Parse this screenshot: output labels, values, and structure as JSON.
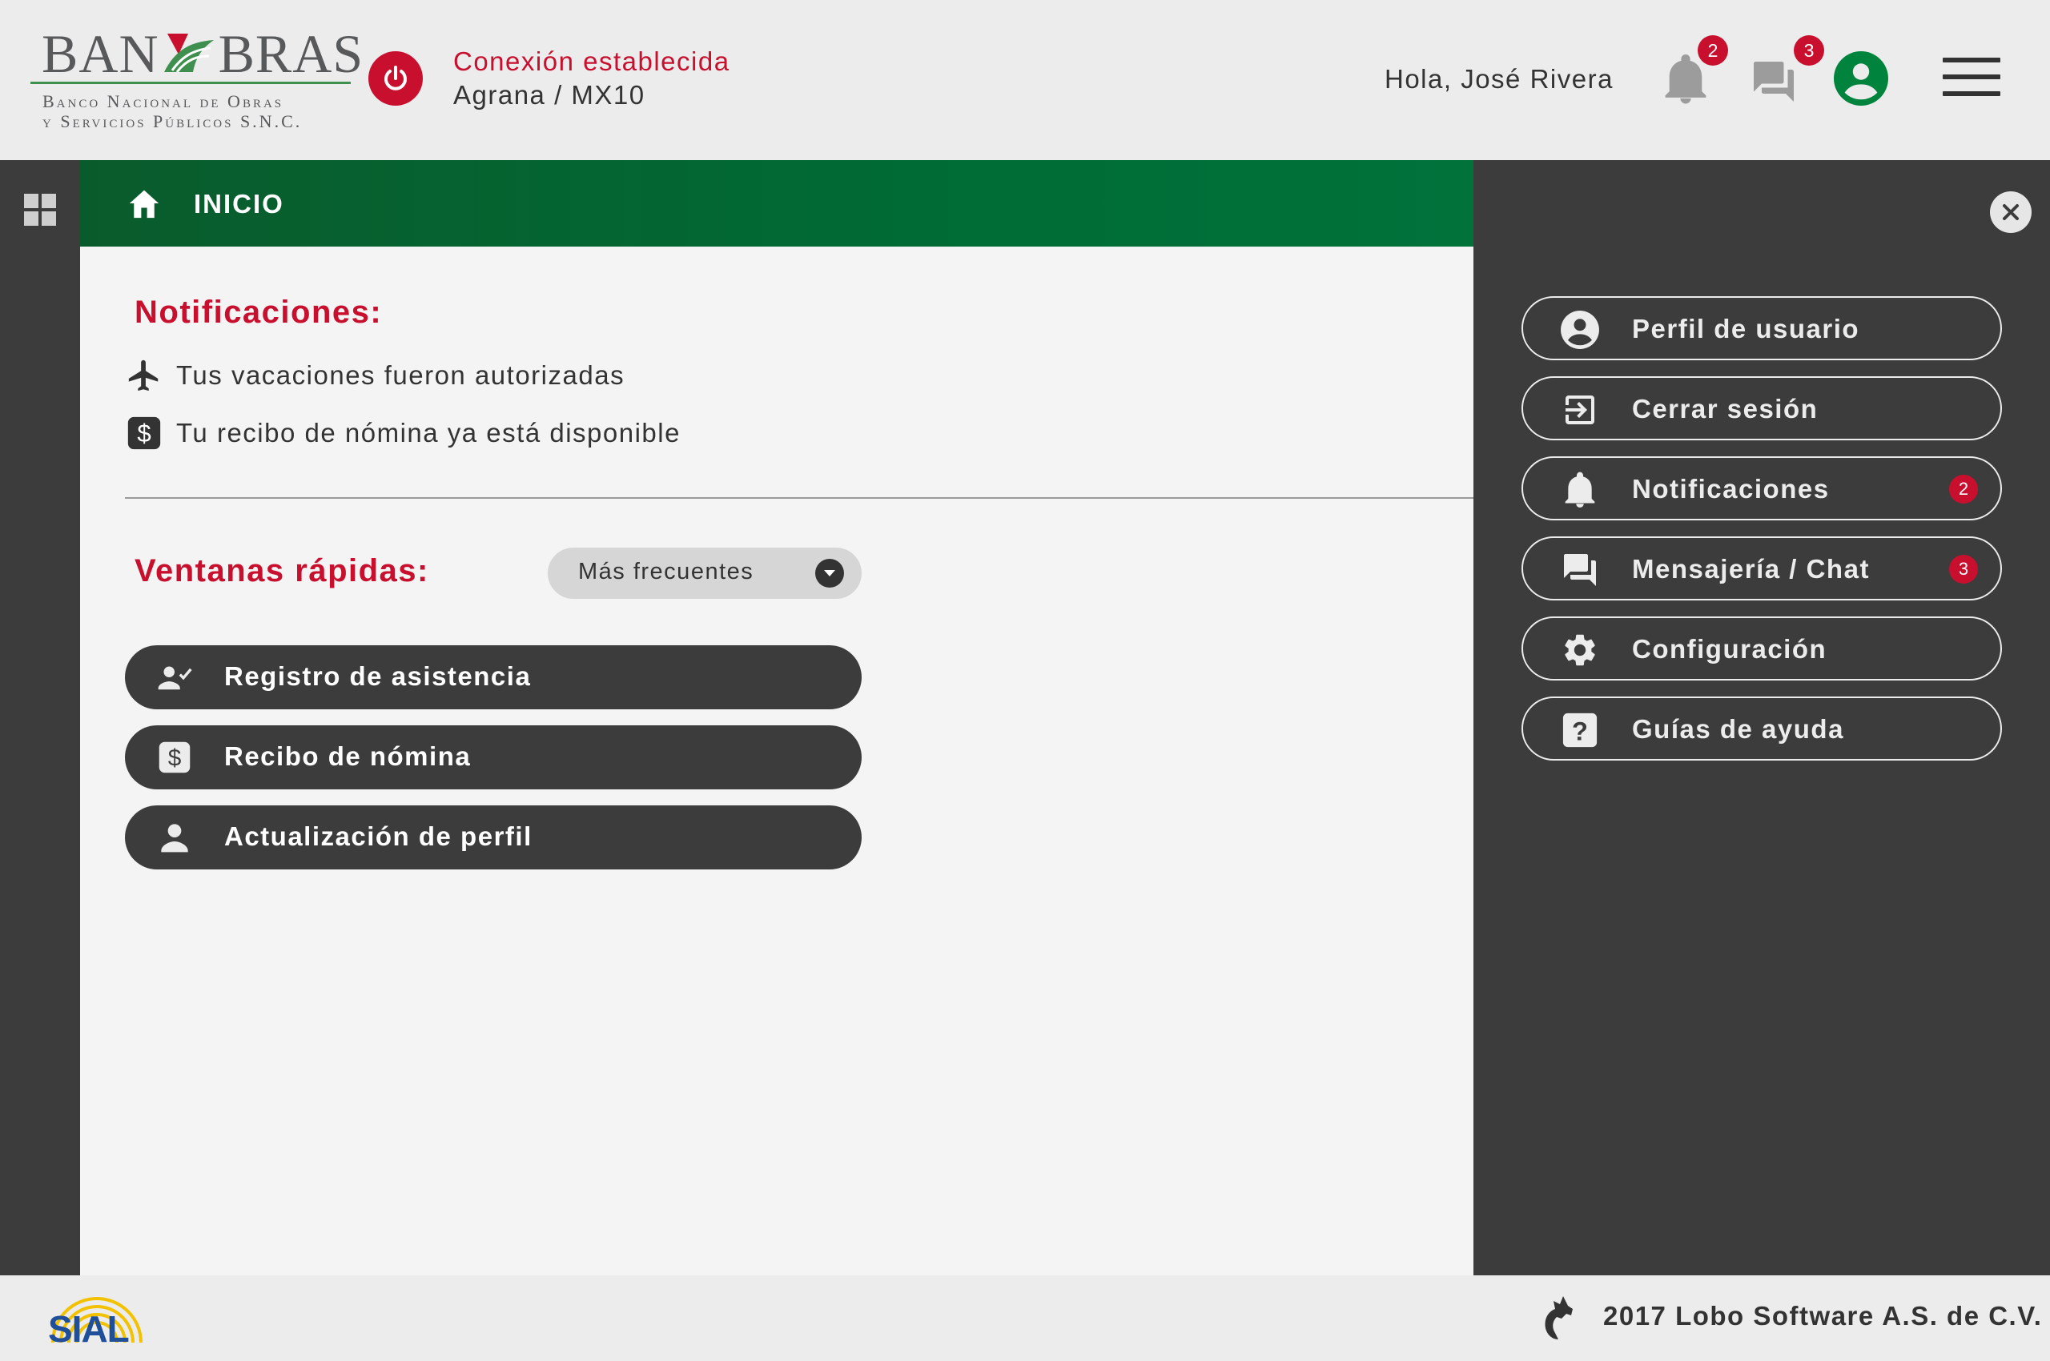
{
  "brand": {
    "logo_left": "BAN",
    "logo_right": "BRAS",
    "logo_subtitle_1": "Banco Nacional de Obras",
    "logo_subtitle_2": "y Servicios Públicos S.N.C.",
    "accent_green": "#006b35",
    "accent_red": "#c8102e"
  },
  "header": {
    "connection_status": "Conexión establecida",
    "connection_server": "Agrana / MX10",
    "greeting": "Hola, José Rivera",
    "notifications_count": "2",
    "messages_count": "3"
  },
  "topbar": {
    "title": "INICIO"
  },
  "notifications": {
    "title": "Notificaciones:",
    "items": [
      {
        "icon": "airplane-icon",
        "text": "Tus vacaciones fueron autorizadas"
      },
      {
        "icon": "dollar-icon",
        "text": "Tu recibo de nómina ya está disponible"
      }
    ]
  },
  "quick_windows": {
    "title": "Ventanas rápidas:",
    "filter_selected": "Más frecuentes",
    "buttons": [
      {
        "icon": "person-check-icon",
        "label": "Registro de asistencia"
      },
      {
        "icon": "dollar-icon",
        "label": "Recibo de nómina"
      },
      {
        "icon": "person-icon",
        "label": "Actualización de perfil"
      }
    ]
  },
  "side_menu": {
    "items": [
      {
        "icon": "account-circle-icon",
        "label": "Perfil de usuario",
        "badge": ""
      },
      {
        "icon": "logout-icon",
        "label": "Cerrar sesión",
        "badge": ""
      },
      {
        "icon": "bell-icon",
        "label": "Notificaciones",
        "badge": "2"
      },
      {
        "icon": "chat-icon",
        "label": "Mensajería / Chat",
        "badge": "3"
      },
      {
        "icon": "gear-icon",
        "label": "Configuración",
        "badge": ""
      },
      {
        "icon": "help-icon",
        "label": "Guías de ayuda",
        "badge": ""
      }
    ]
  },
  "footer": {
    "app_logo_text": "SIAL",
    "copyright": "2017 Lobo Software A.S. de C.V."
  }
}
